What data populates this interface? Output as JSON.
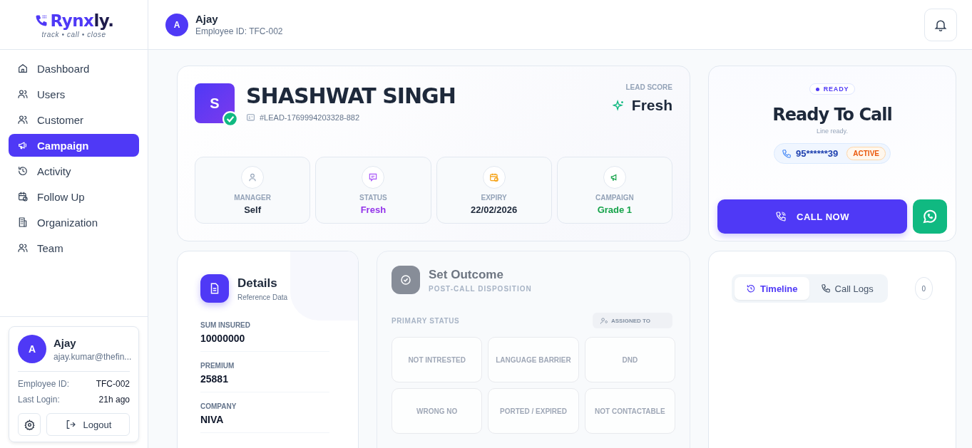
{
  "brand": {
    "name_accent": "Rynx",
    "name_rest": "ly.",
    "tagline": "track • call • close"
  },
  "header": {
    "initial": "A",
    "name": "Ajay",
    "subtitle": "Employee ID: TFC-002"
  },
  "sidebar": {
    "items": [
      {
        "label": "Dashboard",
        "selected": false
      },
      {
        "label": "Users",
        "selected": false
      },
      {
        "label": "Customer",
        "selected": false
      },
      {
        "label": "Campaign",
        "selected": true
      },
      {
        "label": "Activity",
        "selected": false
      },
      {
        "label": "Follow Up",
        "selected": false
      },
      {
        "label": "Organization",
        "selected": false
      },
      {
        "label": "Team",
        "selected": false
      }
    ],
    "profile": {
      "initial": "A",
      "name": "Ajay",
      "email": "ajay.kumar@thefin...",
      "rows": [
        {
          "label": "Employee ID:",
          "value": "TFC-002"
        },
        {
          "label": "Last Login:",
          "value": "21h ago"
        }
      ],
      "logout": "Logout"
    }
  },
  "lead": {
    "initial": "S",
    "verified": true,
    "name": "SHASHWAT SINGH",
    "lead_id": "#LEAD-1769994203328-882",
    "score_label": "LEAD SCORE",
    "score": "Fresh",
    "stats": [
      {
        "label": "MANAGER",
        "value": "Self",
        "color": "#1e293b"
      },
      {
        "label": "STATUS",
        "value": "Fresh",
        "color": "#9333ea"
      },
      {
        "label": "EXPIRY",
        "value": "22/02/2026",
        "color": "#1e293b"
      },
      {
        "label": "CAMPAIGN",
        "value": "Grade 1",
        "color": "#16a34a"
      }
    ]
  },
  "dialer": {
    "badge": "READY",
    "title": "Ready To Call",
    "subtitle": "Line ready.",
    "phone": "95******39",
    "phone_status": "ACTIVE",
    "call_button": "CALL NOW"
  },
  "details": {
    "title": "Details",
    "subtitle": "Reference Data",
    "fields": [
      {
        "label": "SUM INSURED",
        "value": "10000000"
      },
      {
        "label": "PREMIUM",
        "value": "25881"
      },
      {
        "label": "COMPANY",
        "value": "NIVA"
      }
    ]
  },
  "outcome": {
    "disabled": true,
    "title": "Set Outcome",
    "subtitle": "POST-CALL DISPOSITION",
    "primary_label": "PRIMARY STATUS",
    "assigned": "ASSIGNED TO",
    "options": [
      "NOT INTRESTED",
      "LANGUAGE BARRIER",
      "DND",
      "WRONG NO",
      "PORTED / EXPIRED",
      "NOT CONTACTABLE"
    ]
  },
  "activity": {
    "tabs": [
      {
        "label": "Timeline",
        "selected": true
      },
      {
        "label": "Call Logs",
        "selected": false
      }
    ],
    "count": "0"
  }
}
